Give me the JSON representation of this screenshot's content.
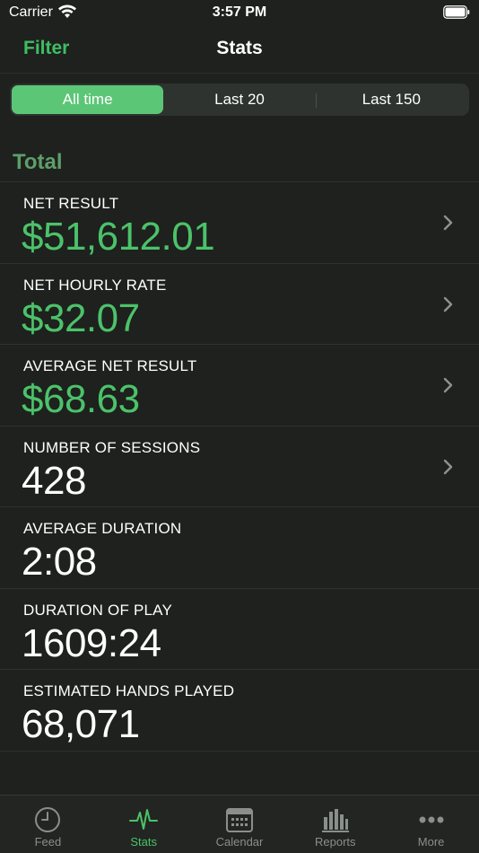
{
  "status_bar": {
    "carrier": "Carrier",
    "time": "3:57 PM"
  },
  "nav": {
    "filter_label": "Filter",
    "title": "Stats"
  },
  "segments": [
    {
      "label": "All time",
      "active": true
    },
    {
      "label": "Last 20",
      "active": false
    },
    {
      "label": "Last 150",
      "active": false
    }
  ],
  "section": {
    "title": "Total"
  },
  "stats": [
    {
      "label": "NET RESULT",
      "value": "$51,612.01",
      "green": true,
      "chevron": true
    },
    {
      "label": "NET HOURLY RATE",
      "value": "$32.07",
      "green": true,
      "chevron": true
    },
    {
      "label": "AVERAGE NET RESULT",
      "value": "$68.63",
      "green": true,
      "chevron": true
    },
    {
      "label": "NUMBER OF SESSIONS",
      "value": "428",
      "green": false,
      "chevron": true
    },
    {
      "label": "AVERAGE DURATION",
      "value": "2:08",
      "green": false,
      "chevron": false
    },
    {
      "label": "DURATION OF PLAY",
      "value": "1609:24",
      "green": false,
      "chevron": false
    },
    {
      "label": "ESTIMATED HANDS PLAYED",
      "value": "68,071",
      "green": false,
      "chevron": false
    }
  ],
  "tabs": [
    {
      "label": "Feed",
      "icon": "clock-icon",
      "active": false
    },
    {
      "label": "Stats",
      "icon": "pulse-icon",
      "active": true
    },
    {
      "label": "Calendar",
      "icon": "calendar-icon",
      "active": false
    },
    {
      "label": "Reports",
      "icon": "bar-chart-icon",
      "active": false
    },
    {
      "label": "More",
      "icon": "more-icon",
      "active": false
    }
  ],
  "colors": {
    "accent": "#4cc26a",
    "segment_active": "#5cc677",
    "background": "#1e211e",
    "section_header": "#5e9e6a"
  }
}
